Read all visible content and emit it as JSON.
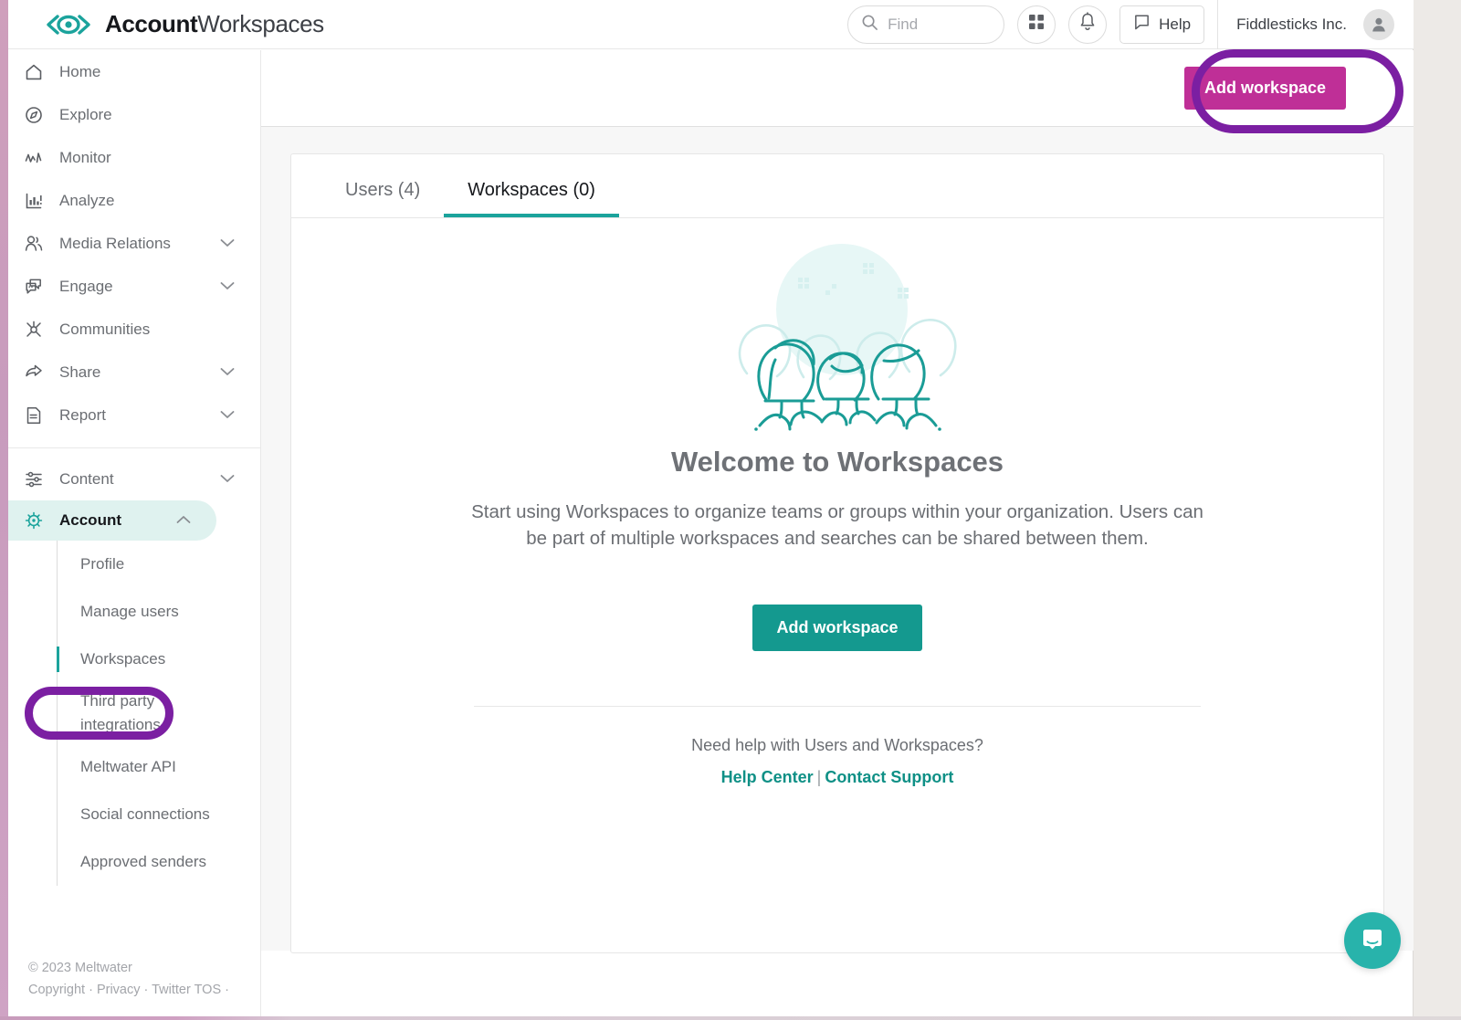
{
  "header": {
    "logo_icon": "meltwater-eye-logo-icon",
    "logo_bold": "Account",
    "logo_normal": "Workspaces",
    "search": {
      "placeholder": "Find",
      "value": "",
      "icon": "search-icon"
    },
    "apps_icon": "grid-apps-icon",
    "notifications_icon": "bell-icon",
    "help_label": "Help",
    "help_icon": "chat-bubble-icon",
    "account_name": "Fiddlesticks Inc.",
    "avatar_icon": "user-avatar-icon"
  },
  "sidebar": {
    "primary": [
      {
        "label": "Home",
        "icon": "home-icon",
        "chevron": false
      },
      {
        "label": "Explore",
        "icon": "compass-icon",
        "chevron": false
      },
      {
        "label": "Monitor",
        "icon": "pulse-icon",
        "chevron": false
      },
      {
        "label": "Analyze",
        "icon": "bar-chart-icon",
        "chevron": false
      },
      {
        "label": "Media Relations",
        "icon": "people-icon",
        "chevron": true
      },
      {
        "label": "Engage",
        "icon": "speech-bubbles-icon",
        "chevron": true
      },
      {
        "label": "Communities",
        "icon": "network-icon",
        "chevron": false
      },
      {
        "label": "Share",
        "icon": "share-arrow-icon",
        "chevron": true
      },
      {
        "label": "Report",
        "icon": "document-icon",
        "chevron": true
      }
    ],
    "secondary": [
      {
        "label": "Content",
        "icon": "sliders-icon",
        "chevron": "down",
        "active": false
      },
      {
        "label": "Account",
        "icon": "gear-icon",
        "chevron": "up",
        "active": true
      }
    ],
    "account_submenu": [
      {
        "label": "Profile",
        "active": false
      },
      {
        "label": "Manage users",
        "active": false
      },
      {
        "label": "Workspaces",
        "active": true
      },
      {
        "label": "Third party integrations",
        "active": false
      },
      {
        "label": "Meltwater API",
        "active": false
      },
      {
        "label": "Social connections",
        "active": false
      },
      {
        "label": "Approved senders",
        "active": false
      }
    ],
    "footer": {
      "copyright": "© 2023 Meltwater",
      "links": "Copyright · Privacy · Twitter TOS ·"
    }
  },
  "topbar": {
    "add_workspace_label": "Add workspace"
  },
  "main": {
    "tabs": [
      {
        "label": "Users (4)",
        "active": false
      },
      {
        "label": "Workspaces (0)",
        "active": true
      }
    ],
    "illustration": "three-people-group-illustration",
    "welcome_title": "Welcome to Workspaces",
    "welcome_desc": "Start using Workspaces to organize teams or groups within your organization. Users can be part of multiple workspaces and searches can be shared between them.",
    "add_workspace_label": "Add workspace",
    "need_help": "Need help with Users and Workspaces?",
    "help_center_link": "Help Center",
    "link_separator": "|",
    "contact_support_link": "Contact Support"
  },
  "chat": {
    "icon": "intercom-chat-icon"
  },
  "colors": {
    "teal": "#1ba39c",
    "teal_button": "#14998f",
    "magenta": "#bf2f97",
    "annotation_purple": "#7b1fa2",
    "link_teal": "#0f9086",
    "active_pill": "#dff2ef"
  }
}
